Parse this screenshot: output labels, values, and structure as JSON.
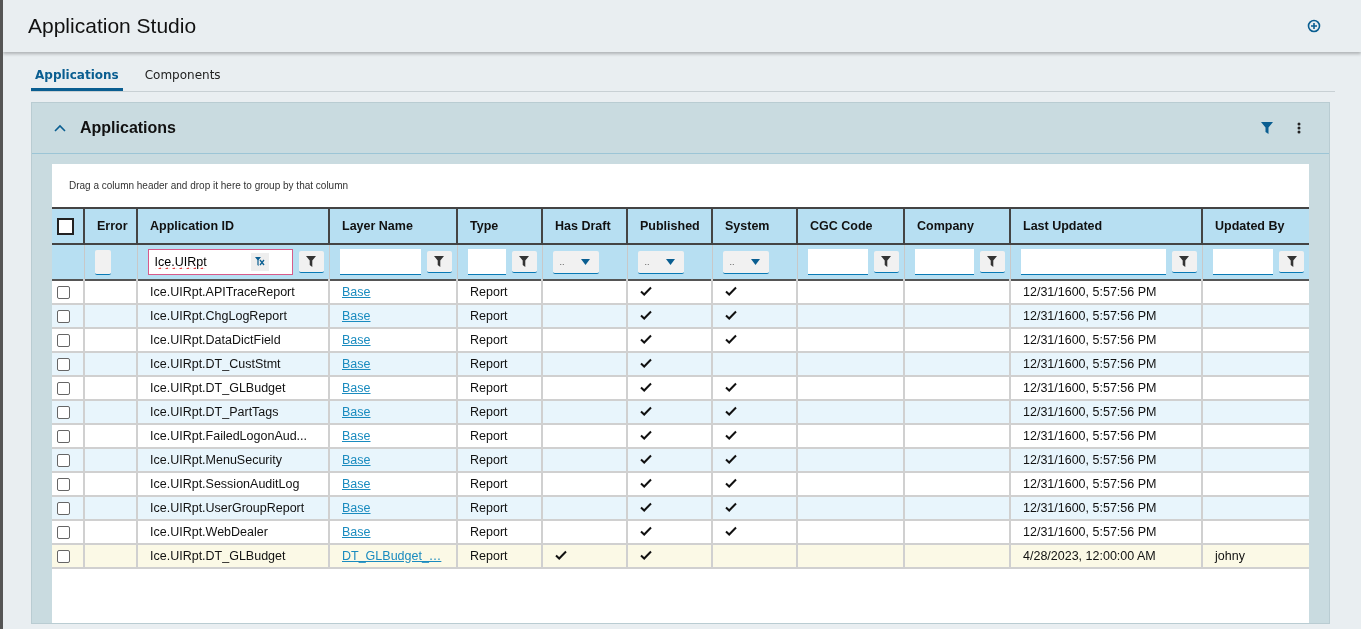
{
  "header": {
    "title": "Application Studio"
  },
  "tabs": [
    {
      "label": "Applications",
      "selected": true
    },
    {
      "label": "Components",
      "selected": false
    }
  ],
  "panel": {
    "title": "Applications",
    "expanded": true,
    "group_hint": "Drag a column header and drop it here to group by that column"
  },
  "table": {
    "select_all": {
      "checked": false
    },
    "columns": [
      {
        "label": "Error",
        "kind": "toggle"
      },
      {
        "label": "Application ID",
        "kind": "text",
        "value": "Ice.UIRpt"
      },
      {
        "label": "Layer Name",
        "kind": "text"
      },
      {
        "label": "Type",
        "kind": "text"
      },
      {
        "label": "Has Draft",
        "kind": "dropdown",
        "value": ".."
      },
      {
        "label": "Published",
        "kind": "dropdown",
        "value": ".."
      },
      {
        "label": "System",
        "kind": "dropdown",
        "value": ".."
      },
      {
        "label": "CGC Code",
        "kind": "text"
      },
      {
        "label": "Company",
        "kind": "text"
      },
      {
        "label": "Last Updated",
        "kind": "text"
      },
      {
        "label": "Updated By",
        "kind": "text"
      }
    ],
    "rows": [
      {
        "checked": false,
        "highlighted": false,
        "app_id": "Ice.UIRpt.APITraceReport",
        "layer": "Base",
        "type": "Report",
        "has_draft": false,
        "published": true,
        "system": true,
        "last_updated": "12/31/1600, 5:57:56 PM"
      },
      {
        "checked": false,
        "highlighted": false,
        "app_id": "Ice.UIRpt.ChgLogReport",
        "layer": "Base",
        "type": "Report",
        "has_draft": false,
        "published": true,
        "system": true,
        "last_updated": "12/31/1600, 5:57:56 PM"
      },
      {
        "checked": false,
        "highlighted": false,
        "app_id": "Ice.UIRpt.DataDictField",
        "layer": "Base",
        "type": "Report",
        "has_draft": false,
        "published": true,
        "system": true,
        "last_updated": "12/31/1600, 5:57:56 PM"
      },
      {
        "checked": false,
        "highlighted": false,
        "app_id": "Ice.UIRpt.DT_CustStmt",
        "layer": "Base",
        "type": "Report",
        "has_draft": false,
        "published": true,
        "system": false,
        "last_updated": "12/31/1600, 5:57:56 PM"
      },
      {
        "checked": false,
        "highlighted": false,
        "app_id": "Ice.UIRpt.DT_GLBudget",
        "layer": "Base",
        "type": "Report",
        "has_draft": false,
        "published": true,
        "system": true,
        "last_updated": "12/31/1600, 5:57:56 PM"
      },
      {
        "checked": false,
        "highlighted": false,
        "app_id": "Ice.UIRpt.DT_PartTags",
        "layer": "Base",
        "type": "Report",
        "has_draft": false,
        "published": true,
        "system": true,
        "last_updated": "12/31/1600, 5:57:56 PM"
      },
      {
        "checked": false,
        "highlighted": false,
        "app_id": "Ice.UIRpt.FailedLogonAud...",
        "layer": "Base",
        "type": "Report",
        "has_draft": false,
        "published": true,
        "system": true,
        "last_updated": "12/31/1600, 5:57:56 PM"
      },
      {
        "checked": false,
        "highlighted": false,
        "app_id": "Ice.UIRpt.MenuSecurity",
        "layer": "Base",
        "type": "Report",
        "has_draft": false,
        "published": true,
        "system": true,
        "last_updated": "12/31/1600, 5:57:56 PM"
      },
      {
        "checked": false,
        "highlighted": false,
        "app_id": "Ice.UIRpt.SessionAuditLog",
        "layer": "Base",
        "type": "Report",
        "has_draft": false,
        "published": true,
        "system": true,
        "last_updated": "12/31/1600, 5:57:56 PM"
      },
      {
        "checked": false,
        "highlighted": false,
        "app_id": "Ice.UIRpt.UserGroupReport",
        "layer": "Base",
        "type": "Report",
        "has_draft": false,
        "published": true,
        "system": true,
        "last_updated": "12/31/1600, 5:57:56 PM"
      },
      {
        "checked": false,
        "highlighted": false,
        "app_id": "Ice.UIRpt.WebDealer",
        "layer": "Base",
        "type": "Report",
        "has_draft": false,
        "published": true,
        "system": true,
        "last_updated": "12/31/1600, 5:57:56 PM"
      },
      {
        "checked": false,
        "highlighted": true,
        "app_id": "Ice.UIRpt.DT_GLBudget",
        "layer": "DT_GLBudget_…",
        "type": "Report",
        "has_draft": true,
        "published": true,
        "system": false,
        "last_updated": "4/28/2023, 12:00:00 AM",
        "updated_by": "johny"
      }
    ]
  }
}
